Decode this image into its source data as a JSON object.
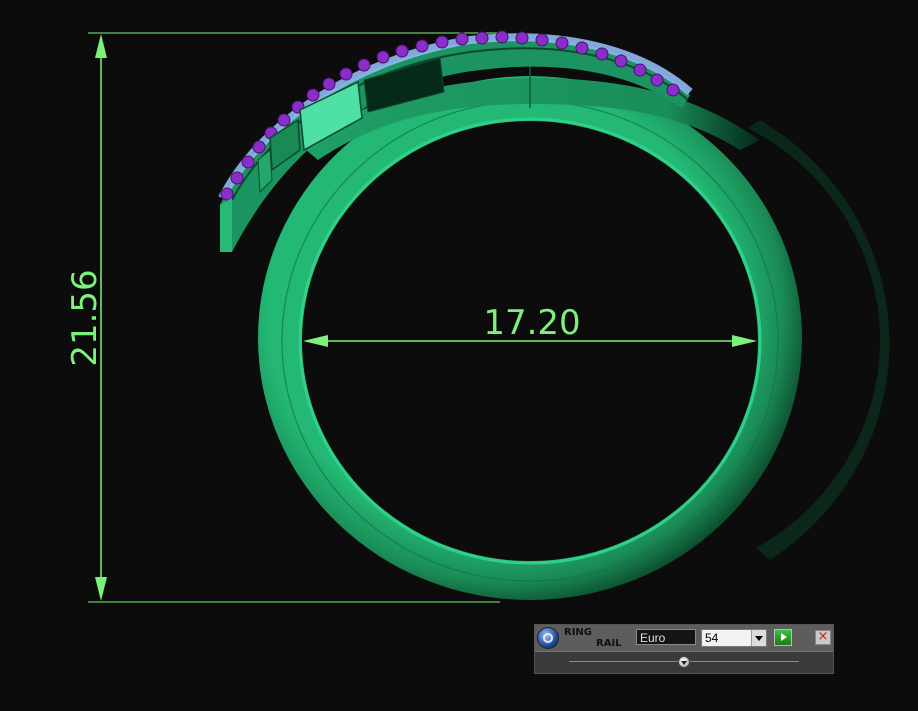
{
  "viewport": {
    "height_dimension": "21.56",
    "width_dimension": "17.20",
    "colors": {
      "background": "#0c0c0c",
      "dimension": "#7cf27c",
      "ring_metal": "#1f9b62",
      "gem_purple": "#8a2ec9",
      "gem_setting_blue": "#8fb8f0"
    }
  },
  "ring_rail": {
    "title_line1": "RING",
    "title_line2": "RAIL",
    "size_standard": "Euro",
    "size_value": "54",
    "slider_fraction": 0.5,
    "icons": {
      "logo": "ring-rail-logo-icon",
      "dropdown": "chevron-down-icon",
      "apply": "play-icon",
      "close": "close-icon",
      "slider": "slider-thumb-icon"
    }
  }
}
